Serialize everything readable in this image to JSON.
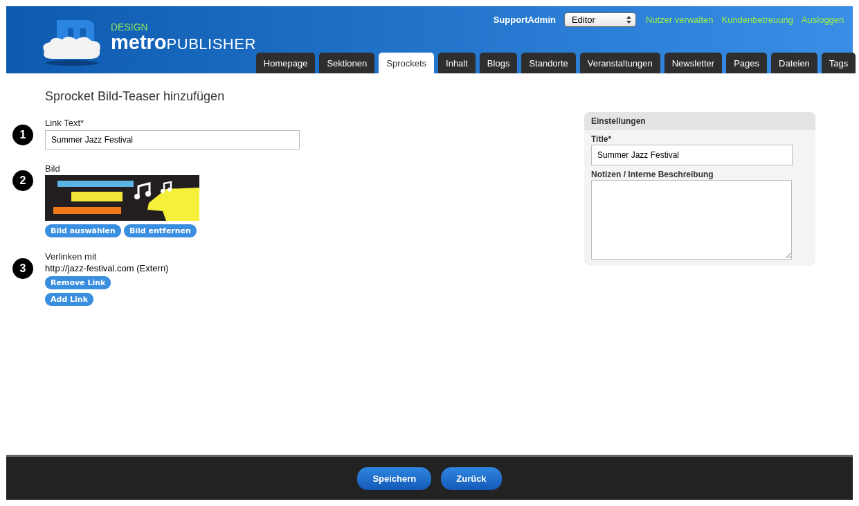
{
  "header": {
    "logo": {
      "tagline": "DESIGN",
      "brand_bold": "metro",
      "brand_light": "PUBLISHER"
    },
    "user": "SupportAdmin",
    "role_select": {
      "value": "Editor"
    },
    "links": [
      "Nutzer verwalten",
      "Kundenbetreuung",
      "Ausloggen"
    ],
    "tabs": [
      {
        "label": "Homepage",
        "selected": false
      },
      {
        "label": "Sektionen",
        "selected": false
      },
      {
        "label": "Sprockets",
        "selected": true
      },
      {
        "label": "Inhalt",
        "selected": false
      },
      {
        "label": "Blogs",
        "selected": false
      },
      {
        "label": "Standorte",
        "selected": false
      },
      {
        "label": "Veranstaltungen",
        "selected": false
      },
      {
        "label": "Newsletter",
        "selected": false
      },
      {
        "label": "Pages",
        "selected": false
      },
      {
        "label": "Dateien",
        "selected": false
      },
      {
        "label": "Tags",
        "selected": false
      }
    ]
  },
  "page_title": "Sprocket Bild-Teaser hinzufügen",
  "steps": [
    {
      "number": "1",
      "label": "Link Text*",
      "kind": "text",
      "value": "Summer Jazz Festival"
    },
    {
      "number": "2",
      "label": "Bild",
      "kind": "image",
      "buttons": [
        "Bild auswählen",
        "Bild entfernen"
      ]
    },
    {
      "number": "3",
      "label": "Verlinken mit",
      "kind": "link",
      "link": "http://jazz-festival.com (Extern)",
      "buttons": [
        "Remove Link",
        "Add Link"
      ]
    }
  ],
  "settings": {
    "title": "Einstellungen",
    "fields": [
      {
        "label": "Title*",
        "kind": "input",
        "value": "Summer Jazz Festival"
      },
      {
        "label": "Notizen / Interne Beschreibung",
        "kind": "textarea"
      }
    ]
  },
  "footer": {
    "buttons": [
      "Speichern",
      "Zurück"
    ]
  }
}
